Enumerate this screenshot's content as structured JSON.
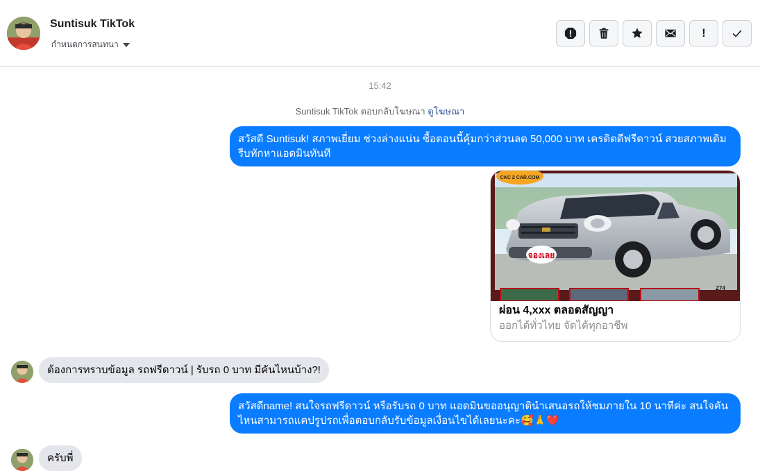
{
  "header": {
    "contact_name": "Suntisuk TikTok",
    "assign_label": "กำหนดการสนทนา",
    "actions": [
      {
        "name": "spam-icon"
      },
      {
        "name": "trash-icon"
      },
      {
        "name": "star-icon"
      },
      {
        "name": "envelope-icon"
      },
      {
        "name": "exclamation-icon",
        "glyph": "!"
      },
      {
        "name": "check-icon"
      }
    ]
  },
  "thread": {
    "timestamp": "15:42",
    "reply_note": "Suntisuk TikTok ตอบกลับโฆษณา",
    "reply_link": "ดูโฆษณา",
    "messages": [
      {
        "from": "page",
        "text": "สวัสดี Suntisuk!  สภาพเยี่ยม ช่วงล่างแน่น  ซื้อตอนนี้คุ้มกว่าส่วนลด 50,000 บาท เครดิตดีฟรีดาวน์  สวยสภาพเดิม รีบทักหาแอดมินทันที"
      },
      {
        "from": "page",
        "card": {
          "image_label_top": "CKC 2 CAR.COM",
          "image_badge": "จองเลย",
          "image_code": "Z74",
          "title": "ผ่อน 4,xxx ตลอดสัญญา",
          "subtitle": "ออกได้ทั่วไทย จัดได้ทุกอาชีพ"
        }
      },
      {
        "from": "user",
        "text": "ต้องการทราบข้อมูล รถฟรีดาวน์ | รับรถ 0 บาท มีคันไหนบ้าง?!"
      },
      {
        "from": "page",
        "text": "สวัสดีname! สนใจรถฟรีดาวน์ หรือรับรถ 0 บาท แอดมินขออนุญาตินำเสนอรถให้ชมภายใน 10 นาทีค่ะ สนใจคันไหนสามารถแคปรูปรถเพื่อตอบกลับรับข้อมูลเงื่อนไขได้เลยนะคะ🥰🙏❤️"
      },
      {
        "from": "user",
        "text": "ครับพี่"
      }
    ]
  },
  "colors": {
    "outgoing_bubble": "#0a7cff",
    "incoming_bubble": "#e4e6eb",
    "link": "#385898"
  }
}
